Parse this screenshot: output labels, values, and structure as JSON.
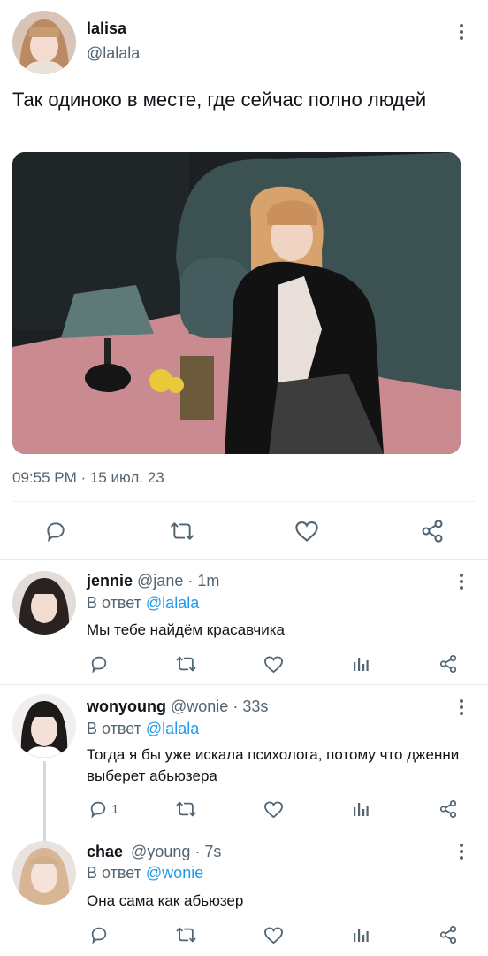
{
  "tweet": {
    "author_name": "lalisa",
    "author_handle": "@lalala",
    "text": "Так одиноко в месте, где сейчас полно людей",
    "timestamp": "09:55 PM · 15 июл. 23"
  },
  "replies": [
    {
      "name": "jennie",
      "handle": "@jane",
      "time": "· 1m",
      "reply_to_label": "В ответ",
      "reply_to": "@lalala",
      "text": "Мы тебе найдём красавчика",
      "reply_count": ""
    },
    {
      "name": "wonyoung",
      "handle": "@wonie",
      "time": "· 33s",
      "reply_to_label": "В ответ",
      "reply_to": "@lalala",
      "text": "Тогда я бы уже искала психолога, потому что дженни выберет абьюзера",
      "reply_count": "1"
    },
    {
      "name": "chae",
      "handle": "@young",
      "time": "· 7s",
      "reply_to_label": "В ответ",
      "reply_to": "@wonie",
      "text": "Она сама как абьюзер",
      "reply_count": ""
    }
  ],
  "colors": {
    "accent": "#1d9bf0",
    "muted": "#536471",
    "text": "#0f1419"
  },
  "icons": [
    "more-icon",
    "reply-icon",
    "retweet-icon",
    "like-icon",
    "share-icon",
    "stats-icon"
  ]
}
